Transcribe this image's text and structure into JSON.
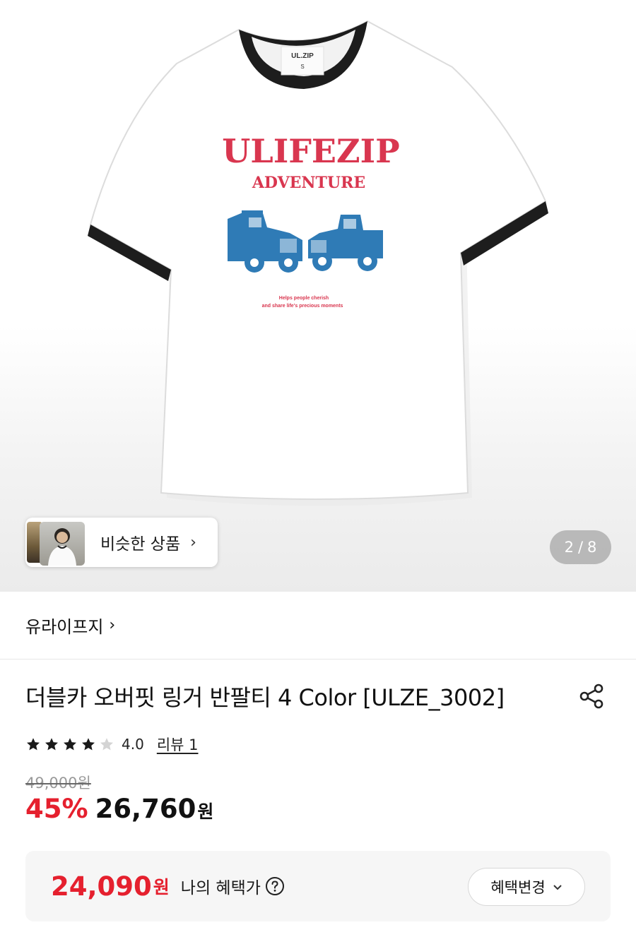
{
  "gallery": {
    "shirt_tag_brand": "UL.ZIP",
    "shirt_tag_size": "S",
    "print_line1": "ULIFEZIP",
    "print_line2": "ADVENTURE",
    "print_caption1": "Helps people cherish",
    "print_caption2": "and share life's precious moments",
    "similar_label": "비슷한 상품",
    "page_current": "2",
    "page_sep": "/",
    "page_total": "8",
    "colors": {
      "print_red": "#d9364f",
      "print_blue": "#2f7bb6",
      "trim": "#1d1d1d"
    }
  },
  "brand": {
    "name": "유라이프지",
    "arrow": "›"
  },
  "product": {
    "title": "더블카 오버핏 링거 반팔티 4 Color [ULZE_3002]",
    "rating": {
      "stars_filled": 4,
      "stars_total": 5,
      "value": "4.0",
      "review_label": "리뷰 1"
    },
    "original_price": "49,000원",
    "discount": "45%",
    "sale_price": "26,760",
    "sale_unit": "원"
  },
  "benefit": {
    "price": "24,090",
    "unit": "원",
    "label": "나의 혜택가",
    "button_label": "혜택변경",
    "button_chevron": "⌄"
  },
  "icons": {
    "share": "share-icon",
    "help": "question-circle-icon",
    "star": "star-icon"
  },
  "accent_color": "#e5202e"
}
